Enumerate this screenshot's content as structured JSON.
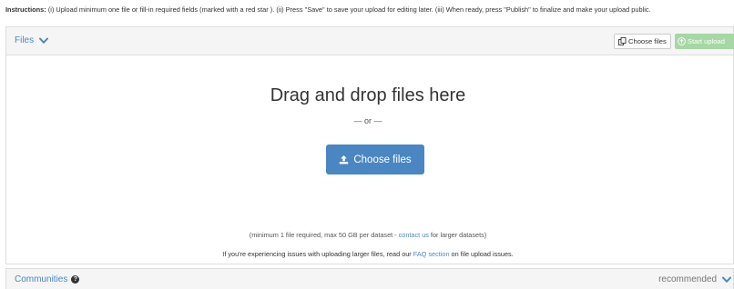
{
  "instructions": {
    "label": "Instructions:",
    "text": " (i) Upload minimum one file or fill-in required fields (marked with a red star ). (ii) Press \"Save\" to save your upload for editing later. (iii) When ready, press \"Publish\" to finalize and make your upload public."
  },
  "files": {
    "title": "Files",
    "choose_files_small": "Choose files",
    "start_upload": "Start upload",
    "drop_title": "Drag and drop files here",
    "or_text": "— or —",
    "choose_files_button": "Choose files",
    "min_note_prefix": "(minimum 1 file required, max 50 GB per dataset - ",
    "contact_link": "contact us",
    "min_note_suffix": " for larger datasets)",
    "issue_prefix": "If you're experiencing issues with uploading larger files, read our ",
    "faq_link": "FAQ section",
    "issue_suffix": " on file upload issues."
  },
  "communities": {
    "title": "Communities",
    "recommended": "recommended"
  },
  "colors": {
    "link_blue": "#4c86c5",
    "primary_button": "#4a86c2",
    "start_upload_green": "#a6d7a4"
  },
  "icons": [
    "chevron-down-icon",
    "copy-files-icon",
    "upload-circle-icon",
    "upload-icon",
    "question-circle-icon"
  ]
}
